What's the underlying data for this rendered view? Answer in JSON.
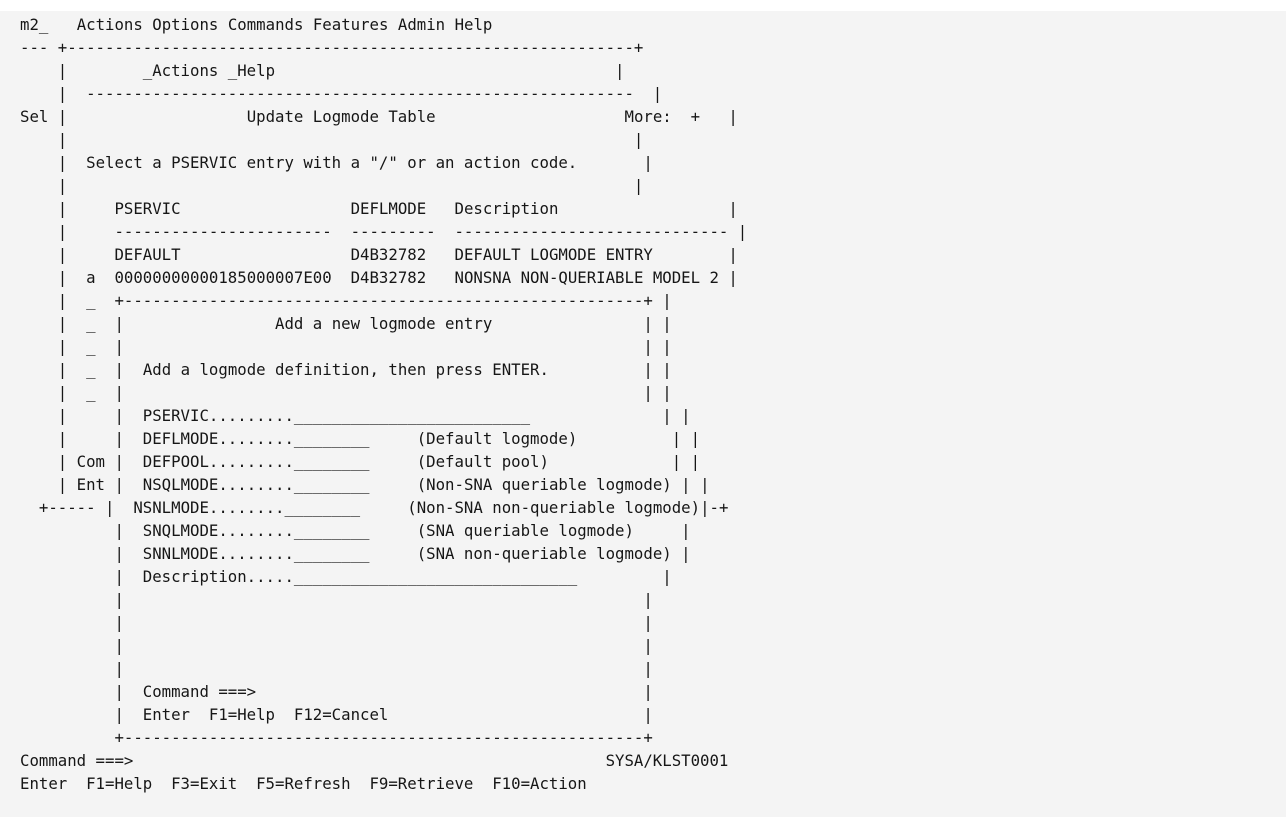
{
  "terminal": {
    "bg_color": "#f4f4f4",
    "text_color": "#161616",
    "cols": 80,
    "rows": 33
  },
  "menubar": {
    "field_value": "m2_",
    "items": [
      "Actions",
      "Options",
      "Commands",
      "Features",
      "Admin",
      "Help"
    ]
  },
  "outer_panel": {
    "side_label": "Sel",
    "actions": [
      "_Actions",
      "_Help"
    ],
    "title": "Update Logmode Table",
    "more_indicator": "More:  +",
    "instruction": "Select a PSERVIC entry with a \"/\" or an action code.",
    "columns": [
      "PSERVIC",
      "DEFLMODE",
      "Description"
    ],
    "rows": [
      {
        "action": "",
        "pservic": "DEFAULT",
        "deflmode": "D4B32782",
        "description": "DEFAULT LOGMODE ENTRY"
      },
      {
        "action": "a",
        "pservic": "00000000000185000007E00",
        "deflmode": "D4B32782",
        "description": "NONSNA NON-QUERIABLE MODEL 2"
      }
    ],
    "hidden_action_fields": [
      "_",
      "_",
      "_",
      "_",
      "_"
    ],
    "command_label": "Com",
    "enter_label": "Ent"
  },
  "dialog": {
    "title": "Add a new logmode entry",
    "instruction": "Add a logmode definition, then press ENTER.",
    "fields": [
      {
        "label": "PSERVIC.........",
        "value": "_________________________",
        "hint": ""
      },
      {
        "label": "DEFLMODE........",
        "value": "________",
        "hint": "(Default logmode)"
      },
      {
        "label": "DEFPOOL.........",
        "value": "________",
        "hint": "(Default pool)"
      },
      {
        "label": "NSQLMODE........",
        "value": "________",
        "hint": "(Non-SNA queriable logmode)"
      },
      {
        "label": "NSNLMODE........",
        "value": "________",
        "hint": "(Non-SNA non-queriable logmode)"
      },
      {
        "label": "SNQLMODE........",
        "value": "________",
        "hint": "(SNA queriable logmode)"
      },
      {
        "label": "SNNLMODE........",
        "value": "________",
        "hint": "(SNA non-queriable logmode)"
      },
      {
        "label": "Description.....",
        "value": "______________________________",
        "hint": ""
      }
    ],
    "command_prompt": "Command ===>",
    "keys": "Enter  F1=Help  F12=Cancel"
  },
  "footer": {
    "command_prompt": "Command ===>",
    "system_id": "SYSA/KLST0001",
    "keys": "Enter  F1=Help  F3=Exit  F5=Refresh  F9=Retrieve  F10=Action"
  }
}
